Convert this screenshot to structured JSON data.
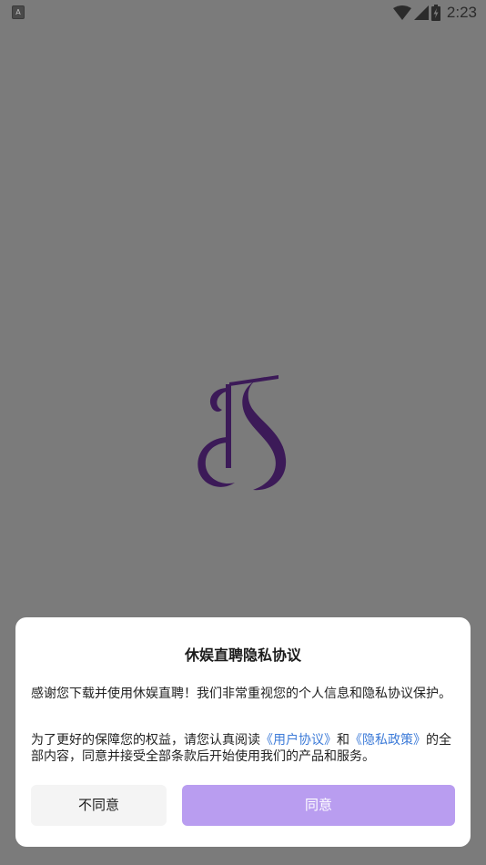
{
  "status_bar": {
    "left_icon": "A",
    "icons": [
      "wifi-icon",
      "signal-icon",
      "battery-charging-icon"
    ],
    "time": "2:23"
  },
  "splash": {
    "logo_icon": "js-monogram-logo",
    "logo_color": "#3c1a58"
  },
  "dialog": {
    "title": "休娱直聘隐私协议",
    "paragraph_1": "感谢您下载并使用休娱直聘！我们非常重视您的个人信息和隐私协议保护。",
    "paragraph_2_before": "为了更好的保障您的权益，请您认真阅读",
    "user_agreement_link": "《用户协议》",
    "paragraph_2_and": "和",
    "privacy_policy_link": "《隐私政策》",
    "paragraph_2_after": "的全部内容，同意并接受全部条款后开始使用我们的产品和服务。",
    "disagree_label": "不同意",
    "agree_label": "同意"
  },
  "colors": {
    "overlay_background": "#7b7b7b",
    "link": "#3d7bd8",
    "agree_button": "#b99df0",
    "disagree_button": "#f4f4f4"
  }
}
